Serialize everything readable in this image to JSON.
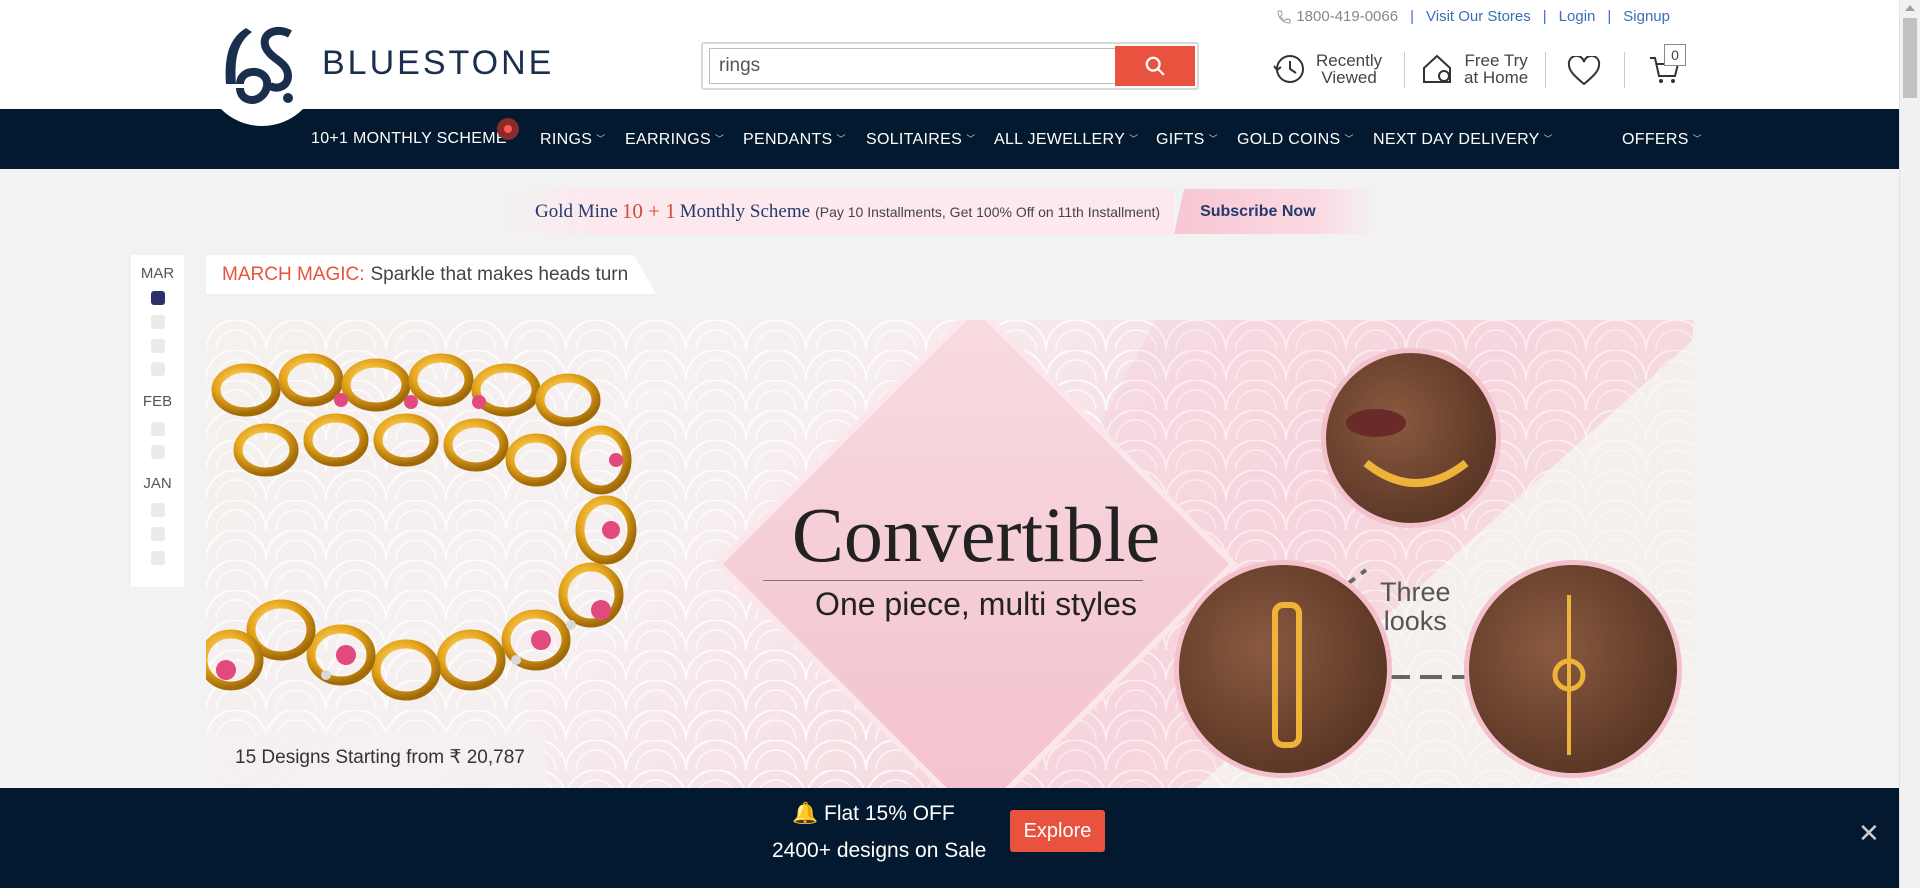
{
  "brand": {
    "name": "BLUESTONE"
  },
  "toplinks": {
    "phone": "1800-419-0066",
    "stores": "Visit Our Stores",
    "login": "Login",
    "signup": "Signup",
    "sep": "|"
  },
  "search": {
    "value": "rings"
  },
  "header": {
    "recent_l1": "Recently",
    "recent_l2": "Viewed",
    "tryhome_l1": "Free Try",
    "tryhome_l2": "at Home",
    "cart_count": "0"
  },
  "nav": [
    {
      "label": "10+1 MONTHLY SCHEME"
    },
    {
      "label": "RINGS"
    },
    {
      "label": "EARRINGS"
    },
    {
      "label": "PENDANTS"
    },
    {
      "label": "SOLITAIRES"
    },
    {
      "label": "ALL JEWELLERY"
    },
    {
      "label": "GIFTS"
    },
    {
      "label": "GOLD COINS"
    },
    {
      "label": "NEXT DAY DELIVERY"
    },
    {
      "label": "OFFERS"
    }
  ],
  "scheme": {
    "title_pre": "Gold Mine",
    "title_num": "10 + 1",
    "title_post": "Monthly Scheme",
    "note": "(Pay 10 Installments, Get 100% Off on 11th Installment)",
    "cta": "Subscribe Now"
  },
  "timeline": {
    "months": [
      "MAR",
      "FEB",
      "JAN"
    ]
  },
  "story": {
    "highlight": "MARCH MAGIC:",
    "text": "Sparkle that makes heads turn"
  },
  "banner": {
    "title": "Convertible",
    "subtitle": "One piece, multi styles",
    "looks_l1": "Three",
    "looks_l2": "looks",
    "designs": "15 Designs Starting from ₹ 20,787"
  },
  "promo": {
    "line1": "Flat 15% OFF",
    "line2": "2400+ designs on Sale",
    "cta": "Explore",
    "close": "✕",
    "bell": "🔔"
  },
  "colors": {
    "navy": "#03192f",
    "accent": "#e8523f",
    "brand": "#1a2f4d"
  }
}
